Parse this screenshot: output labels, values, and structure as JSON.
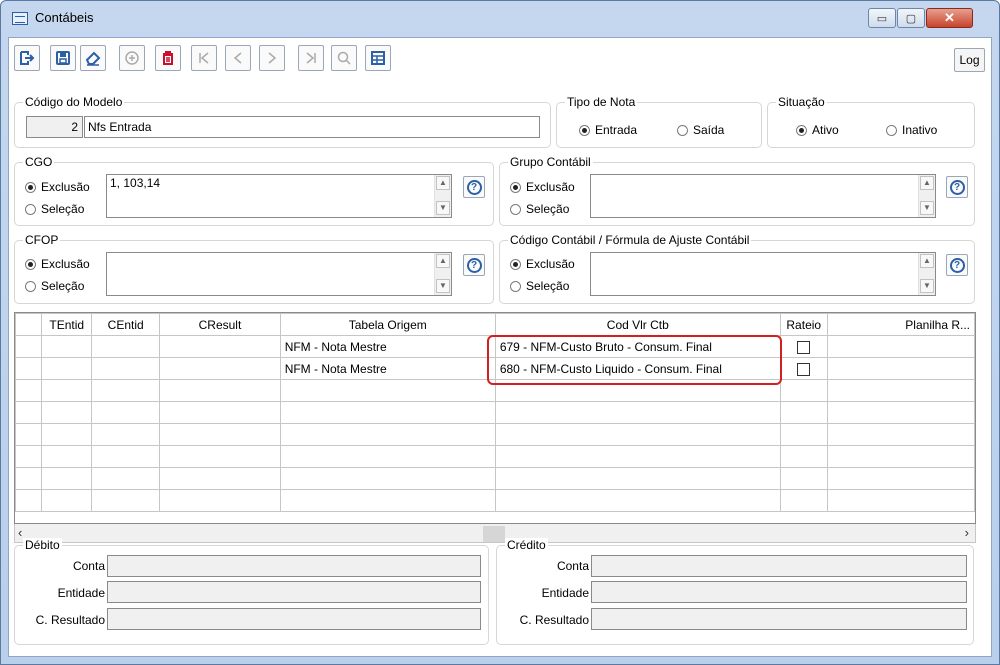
{
  "window": {
    "title": "Contábeis"
  },
  "titlebar_buttons": {
    "minimize": "▭",
    "maximize": "▢",
    "close": "✕"
  },
  "toolbar": {
    "icons": [
      "exit-icon",
      "save-icon",
      "eraser-icon",
      "add-icon",
      "delete-icon",
      "first-icon",
      "prev-icon",
      "next-icon",
      "last-icon",
      "search-icon",
      "table-icon"
    ],
    "log_label": "Log"
  },
  "modelo": {
    "label": "Código do Modelo",
    "code": "2",
    "name": "Nfs Entrada"
  },
  "tipo_nota": {
    "label": "Tipo de Nota",
    "options": [
      "Entrada",
      "Saída"
    ],
    "selected": "Entrada"
  },
  "situacao": {
    "label": "Situação",
    "options": [
      "Ativo",
      "Inativo"
    ],
    "selected": "Ativo"
  },
  "cgo": {
    "label": "CGO",
    "options": [
      "Exclusão",
      "Seleção"
    ],
    "selected": "Exclusão",
    "value": "1, 103,14"
  },
  "grupo_contabil": {
    "label": "Grupo Contábil",
    "options": [
      "Exclusão",
      "Seleção"
    ],
    "selected": "Exclusão",
    "value": ""
  },
  "cfop": {
    "label": "CFOP",
    "options": [
      "Exclusão",
      "Seleção"
    ],
    "selected": "Exclusão",
    "value": ""
  },
  "codigo_contabil": {
    "label": "Código Contábil / Fórmula de Ajuste Contábil",
    "options": [
      "Exclusão",
      "Seleção"
    ],
    "selected": "Exclusão",
    "value": ""
  },
  "help_glyph": "?",
  "grid": {
    "columns": [
      "",
      "TEntid",
      "CEntid",
      "CResult",
      "Tabela Origem",
      "Cod Vlr Ctb",
      "Rateio",
      "Planilha R..."
    ],
    "rows": [
      [
        "",
        "",
        "",
        "",
        "NFM - Nota Mestre",
        "679 - NFM-Custo Bruto - Consum. Final",
        "☐",
        ""
      ],
      [
        "",
        "",
        "",
        "",
        "NFM - Nota Mestre",
        "680 - NFM-Custo Liquido - Consum. Final",
        "☐",
        ""
      ],
      [
        "",
        "",
        "",
        "",
        "",
        "",
        "",
        ""
      ],
      [
        "",
        "",
        "",
        "",
        "",
        "",
        "",
        ""
      ],
      [
        "",
        "",
        "",
        "",
        "",
        "",
        "",
        ""
      ],
      [
        "",
        "",
        "",
        "",
        "",
        "",
        "",
        ""
      ],
      [
        "",
        "",
        "",
        "",
        "",
        "",
        "",
        ""
      ],
      [
        "",
        "",
        "",
        "",
        "",
        "",
        "",
        ""
      ]
    ]
  },
  "debito": {
    "label": "Débito",
    "fields": [
      {
        "label": "Conta",
        "value": ""
      },
      {
        "label": "Entidade",
        "value": ""
      },
      {
        "label": "C. Resultado",
        "value": ""
      }
    ]
  },
  "credito": {
    "label": "Crédito",
    "fields": [
      {
        "label": "Conta",
        "value": ""
      },
      {
        "label": "Entidade",
        "value": ""
      },
      {
        "label": "C. Resultado",
        "value": ""
      }
    ]
  },
  "colors": {
    "highlight": "#d21f1f",
    "accent": "#2b5fa8",
    "delete": "#c8102e"
  }
}
